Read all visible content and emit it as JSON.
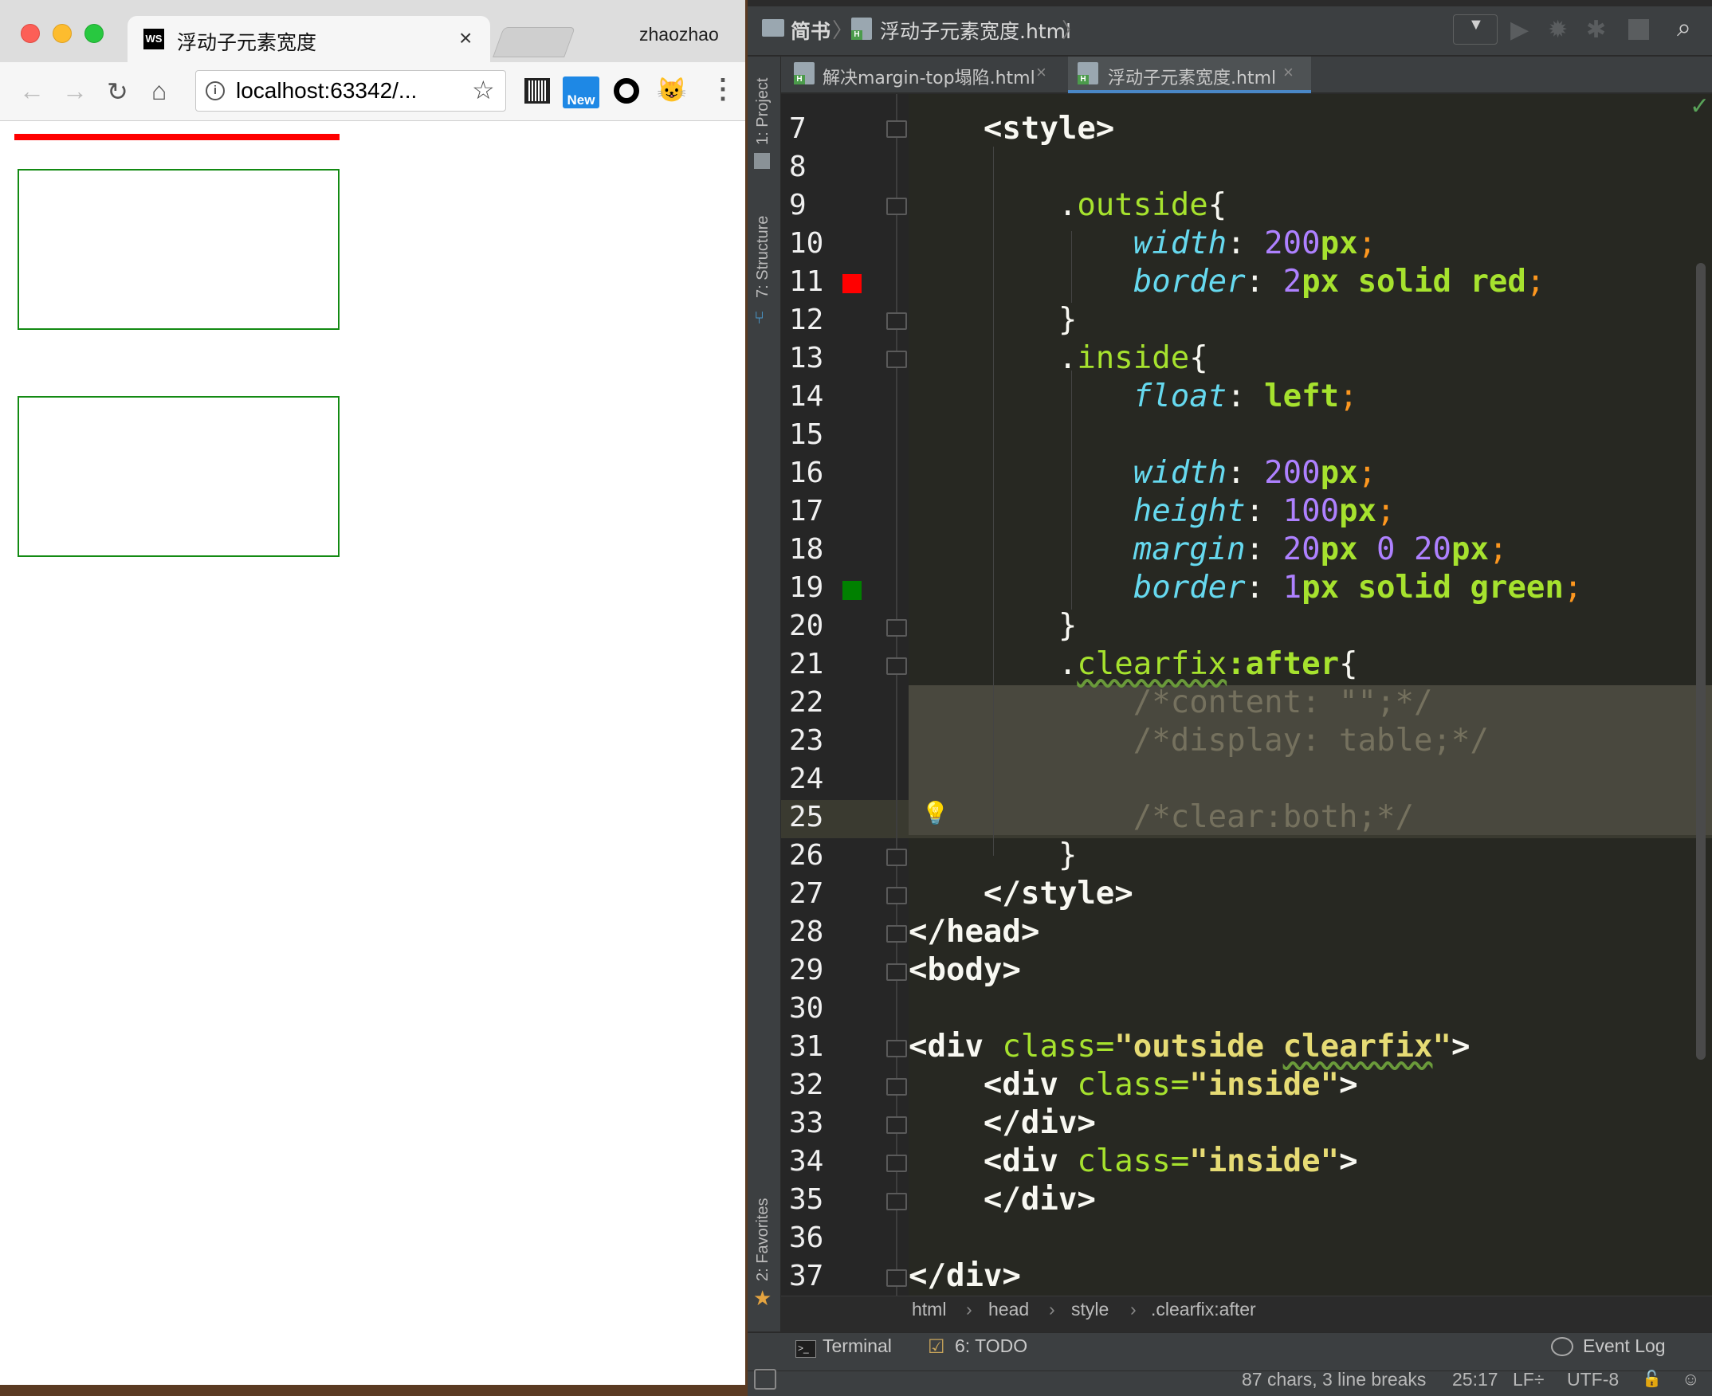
{
  "browser": {
    "tab_title": "浮动子元素宽度",
    "favicon": "WS",
    "profile": "zhaozhao",
    "url_host": "localhost:63342/...",
    "ext_new_label": "New"
  },
  "ide": {
    "navbar": {
      "project": "简书",
      "file": "浮动子元素宽度.html"
    },
    "tool_windows_left": {
      "project": "1: Project",
      "structure": "7: Structure",
      "favorites": "2: Favorites"
    },
    "editor_tabs": [
      {
        "label": "解决margin-top塌陷.html",
        "active": false
      },
      {
        "label": "浮动子元素宽度.html",
        "active": true
      }
    ],
    "line_numbers": [
      "7",
      "8",
      "9",
      "10",
      "11",
      "12",
      "13",
      "14",
      "15",
      "16",
      "17",
      "18",
      "19",
      "20",
      "21",
      "22",
      "23",
      "24",
      "25",
      "26",
      "27",
      "28",
      "29",
      "30",
      "31",
      "32",
      "33",
      "34",
      "35",
      "36",
      "37"
    ],
    "code": {
      "l7_tag": "<style>",
      "l9_sel": "outside",
      "l9_brace": "{",
      "l10_prop": "width",
      "l10_num": "200",
      "l10_unit": "px",
      "l11_prop": "border",
      "l11_num": "2",
      "l11_unit": "px",
      "l11_val": "solid red",
      "l12": "}",
      "l13_sel": "inside",
      "l13_brace": "{",
      "l14_prop": "float",
      "l14_val": "left",
      "l16_prop": "width",
      "l16_num": "200",
      "l16_unit": "px",
      "l17_prop": "height",
      "l17_num": "100",
      "l17_unit": "px",
      "l18_prop": "margin",
      "l18_num1": "20",
      "l18_unit1": "px",
      "l18_num2": "0",
      "l18_num3": "20",
      "l18_unit3": "px",
      "l19_prop": "border",
      "l19_num": "1",
      "l19_unit": "px",
      "l19_val": "solid green",
      "l20": "}",
      "l21_sel": "clearfix",
      "l21_pseudo": ":after",
      "l21_brace": "{",
      "l22": "/*content: \"\";*/",
      "l23": "/*display: table;*/",
      "l25": "/*clear:both;*/",
      "l26": "}",
      "l27_tag": "</style>",
      "l28_tag": "</head>",
      "l29_tag": "<body>",
      "l31_open": "<div",
      "l31_attr": "class=",
      "l31_str_a": "\"outside ",
      "l31_str_b": "clearfix",
      "l31_str_c": "\"",
      "l31_close": ">",
      "l32_open": "<div",
      "l32_attr": "class=",
      "l32_str": "\"inside\"",
      "l32_close": ">",
      "l33_tag": "</div>",
      "l34_open": "<div",
      "l34_attr": "class=",
      "l34_str": "\"inside\"",
      "l34_close": ">",
      "l35_tag": "</div>",
      "l37_tag": "</div>"
    },
    "code_breadcrumbs": [
      "html",
      "head",
      "style",
      ".clearfix:after"
    ],
    "bottom_tools": {
      "terminal": "Terminal",
      "todo": "6: TODO",
      "event_log": "Event Log"
    },
    "status": {
      "selection": "87 chars, 3 line breaks",
      "position": "25:17",
      "line_sep": "LF÷",
      "encoding": "UTF-8"
    },
    "colors": {
      "swatch_red": "#ff0000",
      "swatch_green": "#008000"
    }
  }
}
